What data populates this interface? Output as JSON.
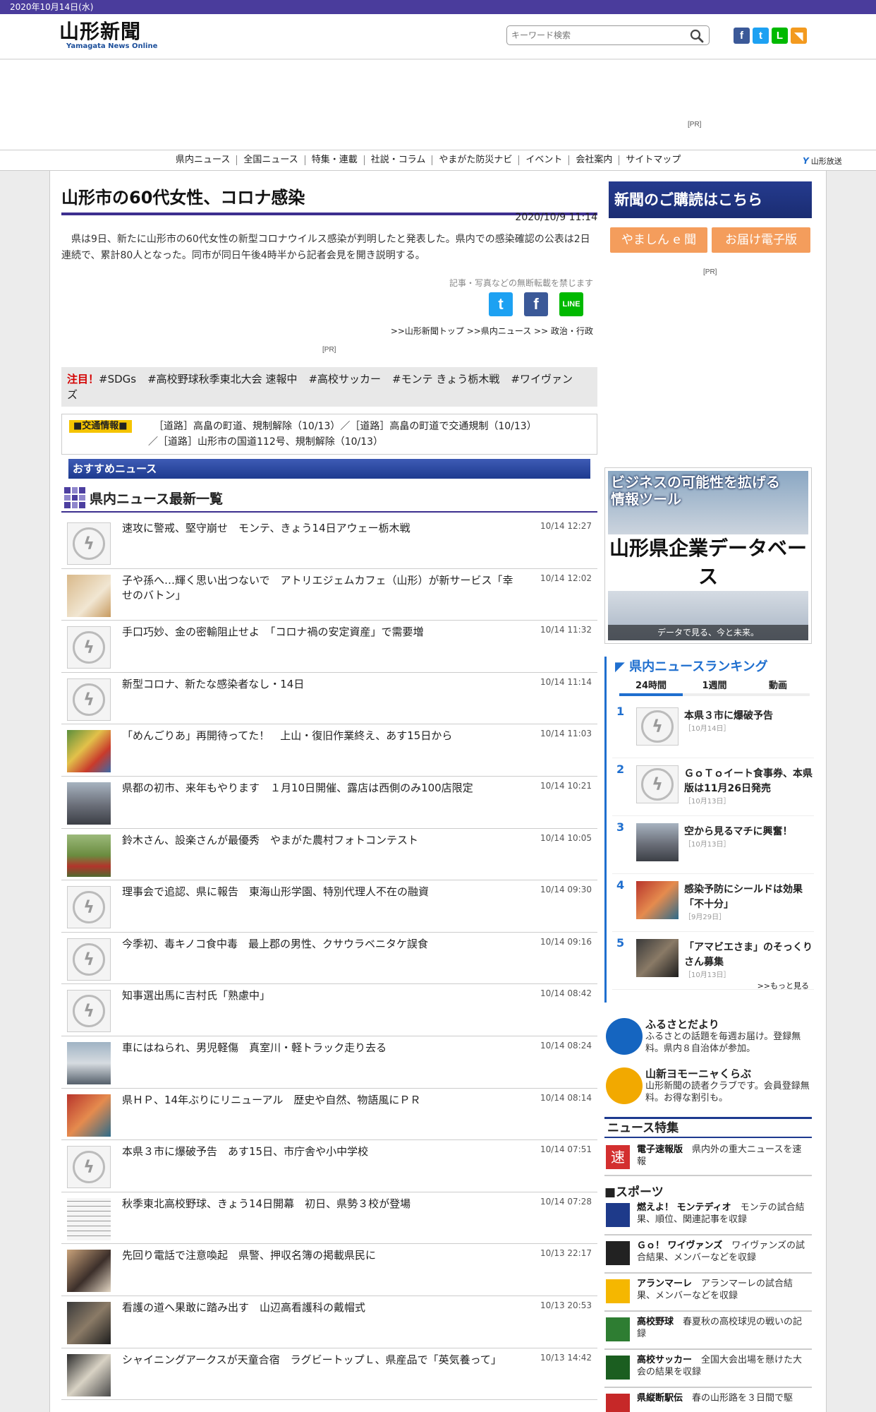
{
  "topbar": {
    "date": "2020年10月14日(水)"
  },
  "header": {
    "logo_main": "山形新聞",
    "logo_sub": "Yamagata News Online",
    "search_placeholder": "キーワード検索",
    "social": [
      {
        "name": "facebook-icon",
        "glyph": "f",
        "color": "#3b5998"
      },
      {
        "name": "twitter-icon",
        "glyph": "t",
        "color": "#1da1f2"
      },
      {
        "name": "line-icon",
        "glyph": "L",
        "color": "#00b900"
      },
      {
        "name": "rss-icon",
        "glyph": "◥",
        "color": "#f39a1f"
      }
    ]
  },
  "ad": {
    "pr_label": "[PR]"
  },
  "nav": {
    "items": [
      "県内ニュース",
      "全国ニュース",
      "特集・連載",
      "社説・コラム",
      "やまがた防災ナビ",
      "イベント",
      "会社案内",
      "サイトマップ"
    ],
    "broadcaster": "山形放送"
  },
  "article": {
    "title": "山形市の60代女性、コロナ感染",
    "date": "2020/10/9 11:14",
    "lead": "県は9日、新たに山形市の60代女性の新型コロナウイルス感染が判明したと発表した。県内での感染確認の公表は2日連続で、累計80人となった。同市が同日午後4時半から記者会見を開き説明する。",
    "notice": "記事・写真などの無断転載を禁じます",
    "breadcrumb": ">>山形新聞トップ >>県内ニュース >> 政治・行政",
    "pr_label": "[PR]"
  },
  "attention": {
    "label": "注目！",
    "tags": [
      "#SDGs",
      "#高校野球秋季東北大会 速報中",
      "#高校サッカー",
      "#モンテ きょう栃木戦",
      "#ワイヴァンズ"
    ]
  },
  "traffic": {
    "label": "■交通情報■",
    "line1": "［道路］高畠の町道、規制解除（10/13）／［道路］高畠の町道で交通規制（10/13）",
    "line2": "／［道路］山形市の国道112号、規制解除（10/13）"
  },
  "recommended": {
    "label": "おすすめニュース"
  },
  "news_list": {
    "title": "県内ニュース最新一覧",
    "items": [
      {
        "headline": "速攻に警戒、堅守崩せ　モンテ、きょう14日アウェー栃木戦",
        "time": "10/14 12:27",
        "thumb": "flash"
      },
      {
        "headline": "子や孫へ…輝く思い出つないで　アトリエジェムカフェ（山形）が新サービス「幸せのバトン」",
        "time": "10/14 12:02",
        "thumb": "photo-tan"
      },
      {
        "headline": "手口巧妙、金の密輸阻止せよ　「コロナ禍の安定資産」で需要増",
        "time": "10/14 11:32",
        "thumb": "flash"
      },
      {
        "headline": "新型コロナ、新たな感染者なし・14日",
        "time": "10/14 11:14",
        "thumb": "flash"
      },
      {
        "headline": "「めんごりあ」再開待ってた！　上山・復旧作業終え、あす15日から",
        "time": "10/14 11:03",
        "thumb": "photo-colorful"
      },
      {
        "headline": "県都の初市、来年もやります　１月10日開催、露店は西側のみ100店限定",
        "time": "10/14 10:21",
        "thumb": "photo-street"
      },
      {
        "headline": "鈴木さん、設楽さんが最優秀　やまがた農村フォトコンテスト",
        "time": "10/14 10:05",
        "thumb": "photo-field"
      },
      {
        "headline": "理事会で追認、県に報告　東海山形学園、特別代理人不在の融資",
        "time": "10/14 09:30",
        "thumb": "flash"
      },
      {
        "headline": "今季初、毒キノコ食中毒　最上郡の男性、クサウラベニタケ誤食",
        "time": "10/14 09:16",
        "thumb": "flash"
      },
      {
        "headline": "知事選出馬に吉村氏「熟慮中」",
        "time": "10/14 08:42",
        "thumb": "flash"
      },
      {
        "headline": "車にはねられ、男児軽傷　真室川・軽トラック走り去る",
        "time": "10/14 08:24",
        "thumb": "photo-car"
      },
      {
        "headline": "県ＨＰ、14年ぶりにリニューアル　歴史や自然、物語風にＰＲ",
        "time": "10/14 08:14",
        "thumb": "photo-red"
      },
      {
        "headline": "本県３市に爆破予告　あす15日、市庁舎や小中学校",
        "time": "10/14 07:51",
        "thumb": "flash"
      },
      {
        "headline": "秋季東北高校野球、きょう14日開幕　初日、県勢３校が登場",
        "time": "10/14 07:28",
        "thumb": "photo-table"
      },
      {
        "headline": "先回り電話で注意喚起　県警、押収名簿の掲載県民に",
        "time": "10/13 22:17",
        "thumb": "photo-phone"
      },
      {
        "headline": "看護の道へ果敢に踏み出す　山辺高看護科の戴帽式",
        "time": "10/13 20:53",
        "thumb": "photo-dark"
      },
      {
        "headline": "シャイニングアークスが天童合宿　ラグビートップＬ、県産品で「英気養って」",
        "time": "10/13 14:42",
        "thumb": "photo-people"
      }
    ]
  },
  "sidebar": {
    "subscribe": "新聞のご購読はこちら",
    "sub_buttons": [
      "やましん e 聞",
      "お届け電子版"
    ],
    "pr_label": "[PR]",
    "db_banner": {
      "top": "ビジネスの可能性を拡げる情報ツール",
      "mid": "山形県企業データベース",
      "bottom": "データで見る、今と未来。"
    },
    "ranking": {
      "title": "県内ニュースランキング",
      "tabs": [
        "24時間",
        "1週間",
        "動画"
      ],
      "items": [
        {
          "num": "1",
          "title": "本県３市に爆破予告",
          "date": "［10月14日］",
          "thumb": "flash"
        },
        {
          "num": "2",
          "title": "ＧｏＴｏイート食事券、本県版は11月26日発売",
          "date": "［10月13日］",
          "thumb": "flash"
        },
        {
          "num": "3",
          "title": "空から見るマチに興奮！",
          "date": "［10月13日］",
          "thumb": "photo-street"
        },
        {
          "num": "4",
          "title": "感染予防にシールドは効果「不十分」",
          "date": "［9月29日］",
          "thumb": "photo-red"
        },
        {
          "num": "5",
          "title": "「アマビエさま」のそっくりさん募集",
          "date": "［10月13日］",
          "thumb": "photo-dark"
        }
      ],
      "more": ">>もっと見る"
    },
    "promos": [
      {
        "title": "ふるさとだより",
        "desc": "ふるさとの話題を毎週お届け。登録無料。県内８自治体が参加。",
        "color": "#1565c0"
      },
      {
        "title": "山新ヨモーニャくらぶ",
        "desc": "山形新聞の読者クラブです。会員登録無料。お得な割引も。",
        "color": "#f2a900"
      }
    ],
    "features": {
      "title": "ニュース特集",
      "items": [
        {
          "title": "電子速報版",
          "desc": "県内外の重大ニュースを速報",
          "color": "#d32f2f",
          "glyph": "速"
        }
      ],
      "sports_title": "■スポーツ",
      "sports": [
        {
          "title": "燃えよ！ モンテディオ",
          "desc": "モンテの試合結果、順位、関連記事を収録",
          "color": "#1e3a8a"
        },
        {
          "title": "Ｇｏ！ ワイヴァンズ",
          "desc": "ワイヴァンズの試合結果、メンバーなどを収録",
          "color": "#222222"
        },
        {
          "title": "アランマーレ",
          "desc": "アランマーレの試合結果、メンバーなどを収録",
          "color": "#f5b700"
        },
        {
          "title": "高校野球",
          "desc": "春夏秋の高校球児の戦いの記録",
          "color": "#2e7d32"
        },
        {
          "title": "高校サッカー",
          "desc": "全国大会出場を懸けた大会の結果を収録",
          "color": "#1b5e20"
        },
        {
          "title": "県縦断駅伝",
          "desc": "春の山形路を３日間で駆",
          "color": "#c62828"
        }
      ]
    }
  }
}
